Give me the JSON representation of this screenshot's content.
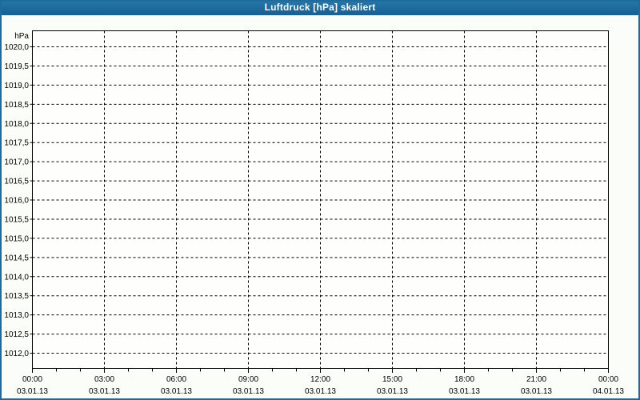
{
  "window": {
    "title": "Luftdruck [hPa] skaliert"
  },
  "colors": {
    "titlebar_bg": "#1e6b9e",
    "titlebar_text": "#ffffff",
    "window_border": "#1e6b9e",
    "window_bg": "#fbfdf8",
    "plot_bg": "#fefefc",
    "grid_line": "#000000",
    "axis_line": "#000000",
    "tick_text": "#000000"
  },
  "chart_data": {
    "type": "line",
    "title": "Luftdruck [hPa] skaliert",
    "xlabel": "",
    "ylabel": "hPa",
    "ylim": [
      1012.0,
      1020.0
    ],
    "y_tick_step": 0.5,
    "grid": "dashed",
    "legend": "none",
    "series": [],
    "y_ticks": [
      {
        "value": 1020.0,
        "label": "1020,0"
      },
      {
        "value": 1019.5,
        "label": "1019,5"
      },
      {
        "value": 1019.0,
        "label": "1019,0"
      },
      {
        "value": 1018.5,
        "label": "1018,5"
      },
      {
        "value": 1018.0,
        "label": "1018,0"
      },
      {
        "value": 1017.5,
        "label": "1017,5"
      },
      {
        "value": 1017.0,
        "label": "1017,0"
      },
      {
        "value": 1016.5,
        "label": "1016,5"
      },
      {
        "value": 1016.0,
        "label": "1016,0"
      },
      {
        "value": 1015.5,
        "label": "1015,5"
      },
      {
        "value": 1015.0,
        "label": "1015,0"
      },
      {
        "value": 1014.5,
        "label": "1014,5"
      },
      {
        "value": 1014.0,
        "label": "1014,0"
      },
      {
        "value": 1013.5,
        "label": "1013,5"
      },
      {
        "value": 1013.0,
        "label": "1013,0"
      },
      {
        "value": 1012.5,
        "label": "1012,5"
      },
      {
        "value": 1012.0,
        "label": "1012,0"
      }
    ],
    "x_range_hours": [
      0,
      24
    ],
    "x_major_step_hours": 3,
    "x_minor_step_hours": 1,
    "x_ticks": [
      {
        "hour": 0,
        "time": "00:00",
        "date": "03.01.13"
      },
      {
        "hour": 3,
        "time": "03:00",
        "date": "03.01.13"
      },
      {
        "hour": 6,
        "time": "06:00",
        "date": "03.01.13"
      },
      {
        "hour": 9,
        "time": "09:00",
        "date": "03.01.13"
      },
      {
        "hour": 12,
        "time": "12:00",
        "date": "03.01.13"
      },
      {
        "hour": 15,
        "time": "15:00",
        "date": "03.01.13"
      },
      {
        "hour": 18,
        "time": "18:00",
        "date": "03.01.13"
      },
      {
        "hour": 21,
        "time": "21:00",
        "date": "03.01.13"
      },
      {
        "hour": 24,
        "time": "00:00",
        "date": "04.01.13"
      }
    ]
  }
}
